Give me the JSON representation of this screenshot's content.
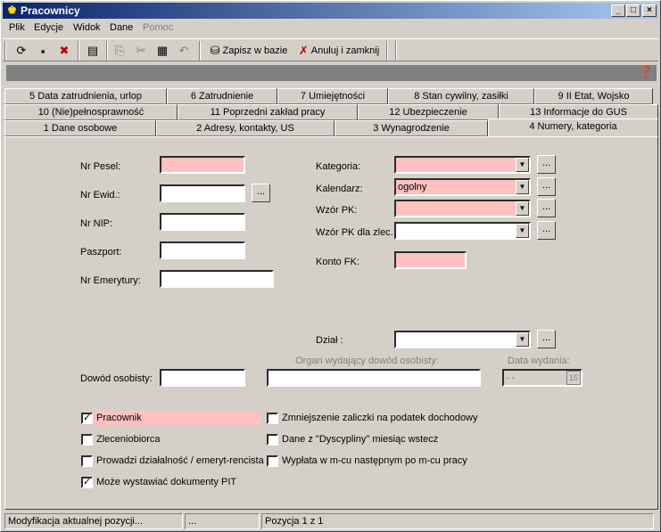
{
  "window": {
    "title": "Pracownicy"
  },
  "menu": {
    "plik": "Plik",
    "edycje": "Edycje",
    "widok": "Widok",
    "dane": "Dane",
    "pomoc": "Pomoc"
  },
  "toolbar": {
    "save_label": "Zapisz w bazie",
    "cancel_label": "Anuluj i zamknij"
  },
  "tabs": {
    "row1": [
      "5 Data zatrudnienia, urlop",
      "6 Zatrudnienie",
      "7 Umiejętności",
      "8 Stan cywilny, zasiłki",
      "9 II Etat, Wojsko"
    ],
    "row2": [
      "10 (Nie)pełnosprawność",
      "11 Poprzedni zakład pracy",
      "12 Ubezpieczenie",
      "13 Informacje do GUS"
    ],
    "row3": [
      "1 Dane osobowe",
      "2 Adresy, kontakty, US",
      "3 Wynagrodzenie",
      "4 Numery, kategoria"
    ]
  },
  "form": {
    "nr_pesel": "Nr Pesel:",
    "nr_ewid": "Nr Ewid.:",
    "nr_nip": "Nr NIP:",
    "paszport": "Paszport:",
    "nr_emerytury": "Nr Emerytury:",
    "kategoria": "Kategoria:",
    "kalendarz": "Kalendarz:",
    "kalendarz_value": "ogolny",
    "wzor_pk": "Wzór PK:",
    "wzor_pk_zlec": "Wzór PK dla zlec.:",
    "konto_fk": "Konto FK:",
    "dzial": "Dział :",
    "organ": "Organ wydający dowód osobisty:",
    "data_wydania": "Data wydania:",
    "data_wydania_value": " -  - ",
    "dowod": "Dowód osobisty:",
    "dots": "..."
  },
  "checks": {
    "pracownik": {
      "label": "Pracownik",
      "checked": true
    },
    "zleceniobiorca": {
      "label": "Zleceniobiorca",
      "checked": false
    },
    "dzialalnosc": {
      "label": "Prowadzi działalność / emeryt-rencista",
      "checked": false
    },
    "pit": {
      "label": "Może wystawiać dokumenty PIT",
      "checked": true
    },
    "zaliczka": {
      "label": "Zmniejszenie zaliczki na podatek dochodowy",
      "checked": false
    },
    "dyscypliny": {
      "label": "Dane z \"Dyscypliny\" miesiąc wstecz",
      "checked": false
    },
    "wyplata": {
      "label": "Wypłata w m-cu następnym po m-cu pracy",
      "checked": false
    }
  },
  "status": {
    "left": "Modyfikacja aktualnej pozycji...",
    "mid": "...",
    "right": "Pozycja 1 z 1"
  },
  "colors": {
    "required": "#ffc0c0",
    "title_start": "#0a246a",
    "title_end": "#a6caf0"
  }
}
